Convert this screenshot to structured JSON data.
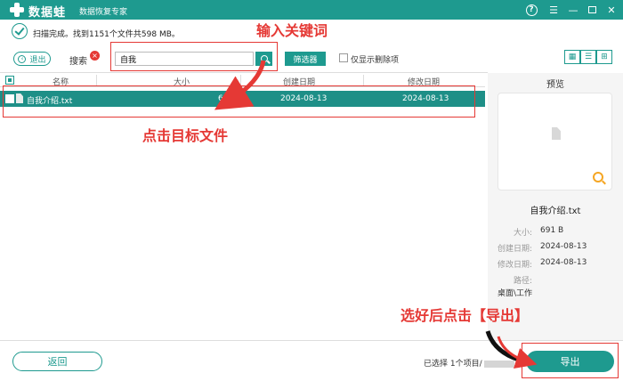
{
  "app": {
    "name": "数据蛙",
    "subtitle": "数据恢复专家"
  },
  "window_controls": {
    "help": "?",
    "menu": "☰",
    "minimize": "—",
    "close": "✕"
  },
  "status": {
    "text": "扫描完成。找到1151个文件共598 MB。"
  },
  "toolbar": {
    "back_label": "退出",
    "back_arrow": "‹",
    "search_label": "搜索",
    "search_clear": "×",
    "search_value": "自我",
    "filter_label": "筛选器",
    "show_deleted_label": "仅显示删除项",
    "view_modes": [
      "▦",
      "☰",
      "⊞"
    ]
  },
  "table": {
    "columns": [
      "名称",
      "大小",
      "创建日期",
      "修改日期"
    ],
    "rows": [
      {
        "name": "自我介绍.txt",
        "size": "691 B",
        "created": "2024-08-13",
        "modified": "2024-08-13"
      }
    ]
  },
  "preview": {
    "title": "预览",
    "filename": "自我介绍.txt",
    "meta": [
      {
        "label": "大小:",
        "value": "691  B"
      },
      {
        "label": "创建日期:",
        "value": "2024-08-13"
      },
      {
        "label": "修改日期:",
        "value": "2024-08-13"
      },
      {
        "label": "路径:",
        "value": "桌面\\工作"
      }
    ]
  },
  "footer": {
    "back_label": "返回",
    "selected_prefix": "已选择 1个项目/",
    "export_label": "导出"
  },
  "annotations": {
    "enter_keyword": "输入关键词",
    "click_file": "点击目标文件",
    "export_hint": "选好后点击【导出】"
  },
  "colors": {
    "primary": "#1e9a8f",
    "row_selected": "#1e8f87",
    "annotation": "#e53935",
    "zoom_icon": "#f5a623"
  }
}
